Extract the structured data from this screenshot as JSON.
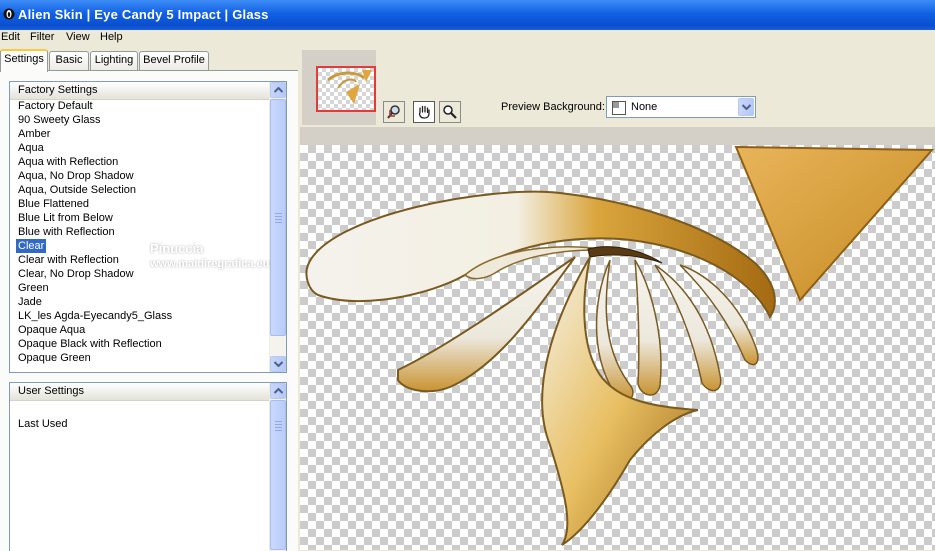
{
  "window": {
    "title": "Alien Skin | Eye Candy 5 Impact | Glass"
  },
  "menu": [
    "Edit",
    "Filter",
    "View",
    "Help"
  ],
  "tabs": [
    "Settings",
    "Basic",
    "Lighting",
    "Bevel Profile"
  ],
  "factory_settings": {
    "header": "Factory Settings",
    "items": [
      "Factory Default",
      "90 Sweety Glass",
      "Amber",
      "Aqua",
      "Aqua with Reflection",
      "Aqua, No Drop Shadow",
      "Aqua, Outside Selection",
      "Blue Flattened",
      "Blue Lit from Below",
      "Blue with Reflection",
      "Clear",
      "Clear with Reflection",
      "Clear, No Drop Shadow",
      "Green",
      "Jade",
      "LK_les Agda-Eyecandy5_Glass",
      "Opaque Aqua",
      "Opaque Black with Reflection",
      "Opaque Green"
    ],
    "selected": "Clear"
  },
  "user_settings": {
    "header": "User Settings",
    "items": [
      "Last Used"
    ]
  },
  "preview": {
    "background_label": "Preview Background:",
    "background_value": "None"
  },
  "watermark": {
    "line1": "Pinuccia",
    "line2": "www.maidiregrafica.eu"
  },
  "tools": [
    "hand-zoom-tool",
    "hand-tool",
    "zoom-tool"
  ],
  "colors": {
    "title_bar": "#0a4fcf",
    "selection": "#316ac5",
    "glass_gold": "#c98a1e",
    "thumb_border": "#e53a3a"
  }
}
